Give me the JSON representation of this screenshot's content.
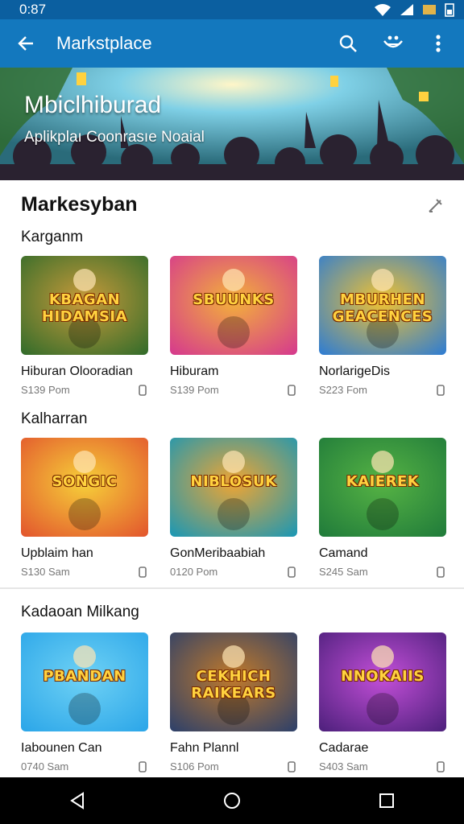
{
  "status": {
    "time": "0:87"
  },
  "appbar": {
    "title": "Markstplace"
  },
  "hero": {
    "title": "Mbiclhiburad",
    "subtitle": "Aplikplaı Coonrasıe Noaial"
  },
  "section": {
    "title": "Markesyban"
  },
  "rows": [
    {
      "label": "Karganm",
      "items": [
        {
          "name": "Hiburan Olooradian",
          "meta": "S139 Pom",
          "art": "KBAGAN HIDAMSIA",
          "colors": [
            "#2f6b2a",
            "#c99a3a"
          ]
        },
        {
          "name": "Hiburam",
          "meta": "S139 Pom",
          "art": "SBUUNKS",
          "colors": [
            "#d5378f",
            "#f3b13a"
          ]
        },
        {
          "name": "NorlarigeDis",
          "meta": "S223 Fom",
          "art": "MBURHEN GEACENCES",
          "colors": [
            "#2a7bd6",
            "#f2c230"
          ]
        }
      ]
    },
    {
      "label": "Kalharran",
      "items": [
        {
          "name": "Upblaim han",
          "meta": "S130 Sam",
          "art": "SONGIC",
          "colors": [
            "#e2532d",
            "#f6d039"
          ]
        },
        {
          "name": "GonMeribaabiah",
          "meta": "0120 Pom",
          "art": "NIBLOSUK",
          "colors": [
            "#1697b7",
            "#f0a532"
          ]
        },
        {
          "name": "Camand",
          "meta": "S245 Sam",
          "art": "KAIEREK",
          "colors": [
            "#1f7a3a",
            "#56b344"
          ]
        }
      ]
    },
    {
      "label": "Kadaoan Milkang",
      "items": [
        {
          "name": "Iabounen Can",
          "meta": "0740 Sam",
          "art": "PBANDAN",
          "colors": [
            "#2aa5e8",
            "#6fd2f5"
          ]
        },
        {
          "name": "Fahn Plannl",
          "meta": "S106 Pom",
          "art": "CEKHICH RAIKEARS",
          "colors": [
            "#2a3f6b",
            "#c27a2a"
          ]
        },
        {
          "name": "Cadarae",
          "meta": "S403 Sam",
          "art": "NNOKAIIS",
          "colors": [
            "#4b1f7a",
            "#c34fd8"
          ]
        }
      ]
    }
  ]
}
